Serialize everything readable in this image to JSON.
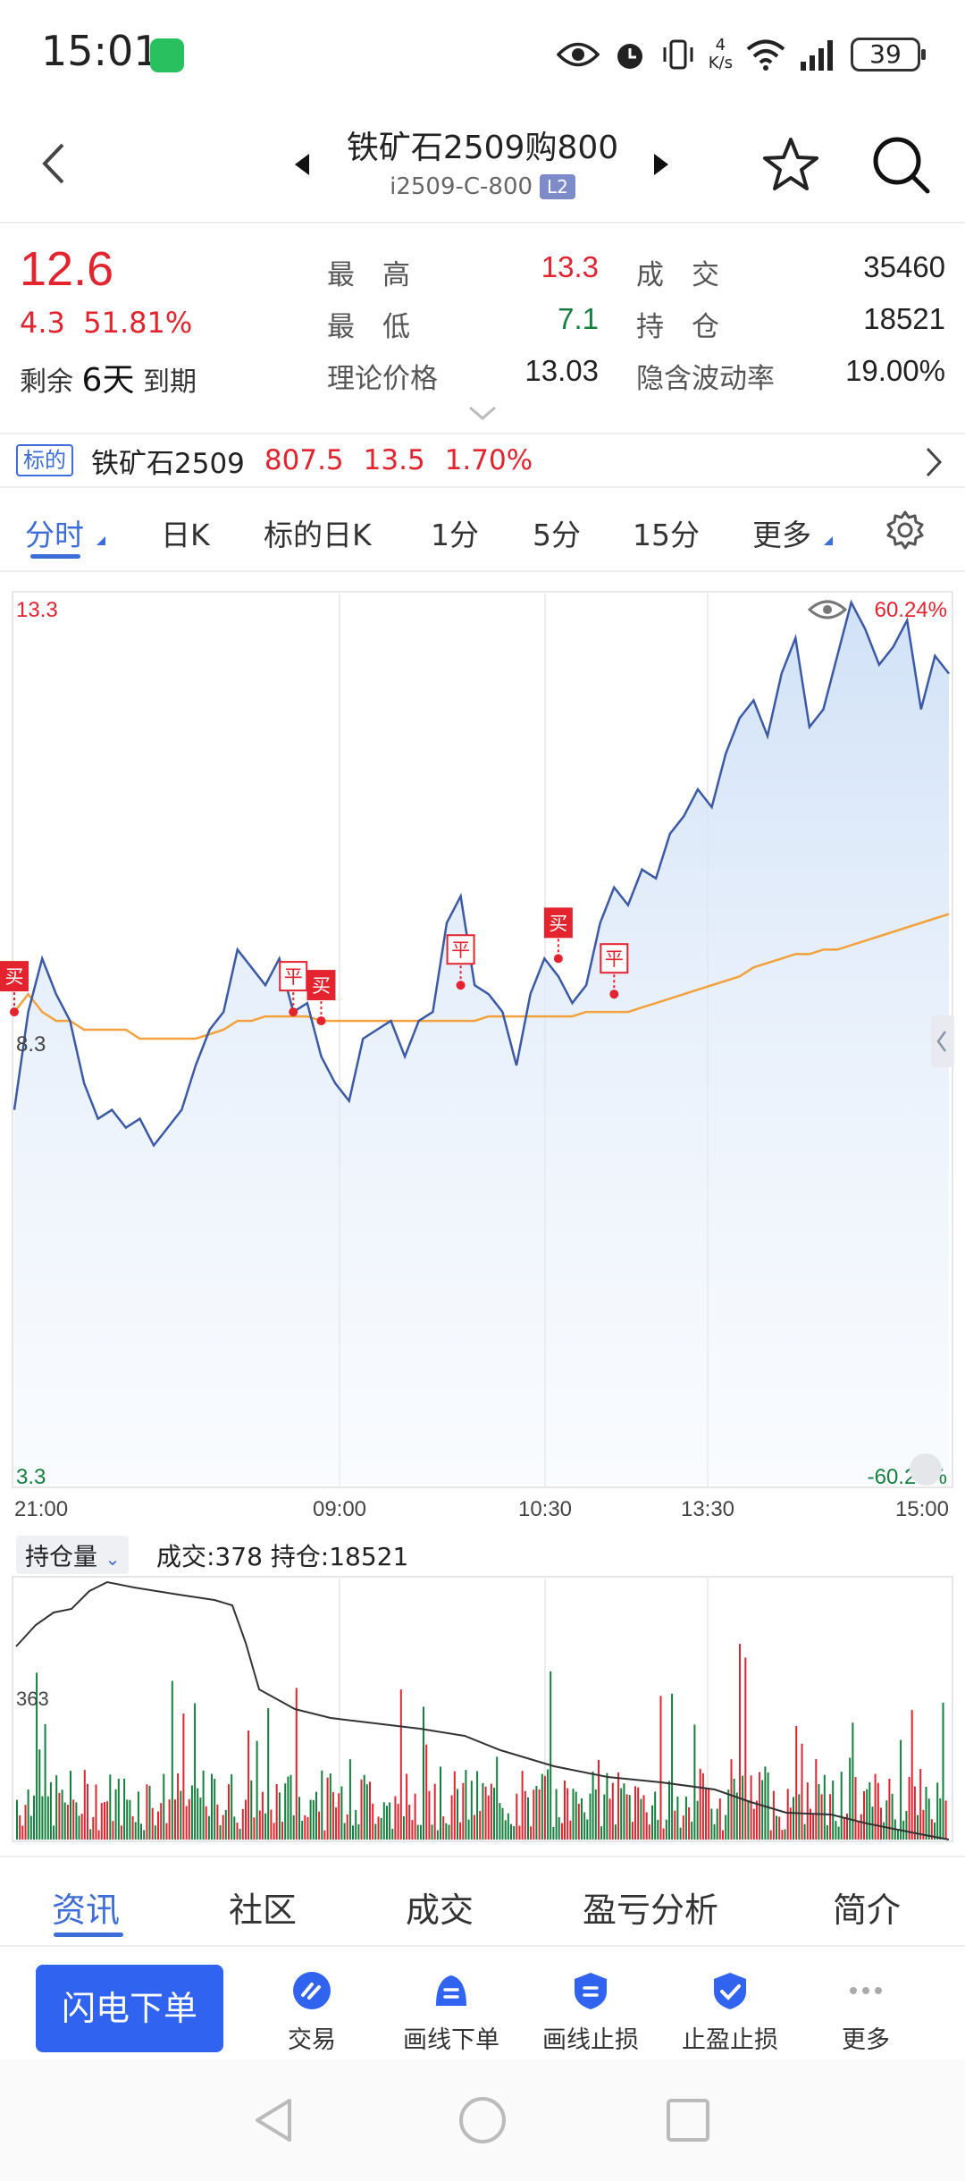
{
  "status": {
    "time": "15:01",
    "net_speed_top": "4",
    "net_speed_bottom": "K/s",
    "battery": "39"
  },
  "header": {
    "title": "铁矿石2509购800",
    "code": "i2509-C-800",
    "badge": "L2"
  },
  "quote": {
    "price": "12.6",
    "change": "4.3",
    "change_pct": "51.81%",
    "remain_prefix": "剩余",
    "remain_days": "6天",
    "remain_suffix": "到期",
    "high_label": "最　高",
    "high": "13.3",
    "low_label": "最　低",
    "low": "7.1",
    "theory_label": "理论价格",
    "theory": "13.03",
    "volume_label": "成　交",
    "volume": "35460",
    "oi_label": "持　仓",
    "oi": "18521",
    "iv_label": "隐含波动率",
    "iv": "19.00%"
  },
  "underlying": {
    "tag": "标的",
    "name": "铁矿石2509",
    "price": "807.5",
    "change": "13.5",
    "change_pct": "1.70%"
  },
  "period_tabs": [
    "分时",
    "日K",
    "标的日K",
    "1分",
    "5分",
    "15分",
    "更多"
  ],
  "chart_data": {
    "type": "line",
    "y_max_label": "13.3",
    "y_min_label": "3.3",
    "y_ref_label": "8.3",
    "pct_max_label": "60.24%",
    "pct_min_label": "-60.24%",
    "ylim": [
      3.3,
      13.3
    ],
    "x_ticks": [
      "21:00",
      "09:00",
      "10:30",
      "13:30",
      "15:00"
    ],
    "series": [
      {
        "values": [
          7.5,
          8.6,
          9.2,
          8.8,
          8.5,
          7.8,
          7.4,
          7.5,
          7.3,
          7.4,
          7.1,
          7.3,
          7.5,
          8.0,
          8.4,
          8.6,
          9.3,
          9.1,
          8.9,
          9.2,
          8.6,
          8.7,
          8.1,
          7.8,
          7.6,
          8.3,
          8.4,
          8.5,
          8.1,
          8.5,
          8.6,
          9.6,
          9.9,
          8.9,
          8.8,
          8.6,
          8.0,
          8.8,
          9.2,
          9.0,
          8.7,
          8.9,
          9.6,
          10.0,
          9.8,
          10.2,
          10.1,
          10.6,
          10.8,
          11.1,
          10.9,
          11.5,
          11.9,
          12.1,
          11.7,
          12.4,
          12.8,
          11.8,
          12.0,
          12.6,
          13.2,
          12.9,
          12.5,
          12.7,
          13.0,
          12.0,
          12.6,
          12.4
        ]
      },
      {
        "values": [
          8.6,
          8.8,
          8.6,
          8.5,
          8.5,
          8.4,
          8.4,
          8.4,
          8.4,
          8.3,
          8.3,
          8.3,
          8.3,
          8.3,
          8.35,
          8.4,
          8.5,
          8.5,
          8.55,
          8.55,
          8.55,
          8.55,
          8.5,
          8.5,
          8.5,
          8.5,
          8.5,
          8.5,
          8.5,
          8.5,
          8.5,
          8.5,
          8.5,
          8.5,
          8.55,
          8.55,
          8.55,
          8.55,
          8.55,
          8.55,
          8.55,
          8.6,
          8.6,
          8.6,
          8.6,
          8.65,
          8.7,
          8.75,
          8.8,
          8.85,
          8.9,
          8.95,
          9.0,
          9.1,
          9.15,
          9.2,
          9.25,
          9.25,
          9.3,
          9.3,
          9.35,
          9.4,
          9.45,
          9.5,
          9.55,
          9.6,
          9.65,
          9.7
        ]
      }
    ],
    "markers": [
      {
        "label": "买",
        "index": 0,
        "value": 8.6
      },
      {
        "label": "平",
        "index": 20,
        "value": 8.6
      },
      {
        "label": "买",
        "index": 22,
        "value": 8.5
      },
      {
        "label": "平",
        "index": 32,
        "value": 8.9
      },
      {
        "label": "买",
        "index": 39,
        "value": 9.2
      },
      {
        "label": "平",
        "index": 43,
        "value": 8.8
      }
    ]
  },
  "volume_panel": {
    "selector": "持仓量",
    "info": "成交:378  持仓:18521",
    "ref_label": "363"
  },
  "info_tabs": [
    "资讯",
    "社区",
    "成交",
    "盈亏分析",
    "简介"
  ],
  "actions": {
    "flash": "闪电下单",
    "trade": "交易",
    "line_order": "画线下单",
    "line_stop": "画线止损",
    "tp_sl": "止盈止损",
    "more": "更多"
  },
  "colors": {
    "up": "#e3232e",
    "down": "#15803d",
    "accent": "#3d6dd8",
    "price_line": "#3a5aa8",
    "avg_line": "#f2a13c"
  }
}
